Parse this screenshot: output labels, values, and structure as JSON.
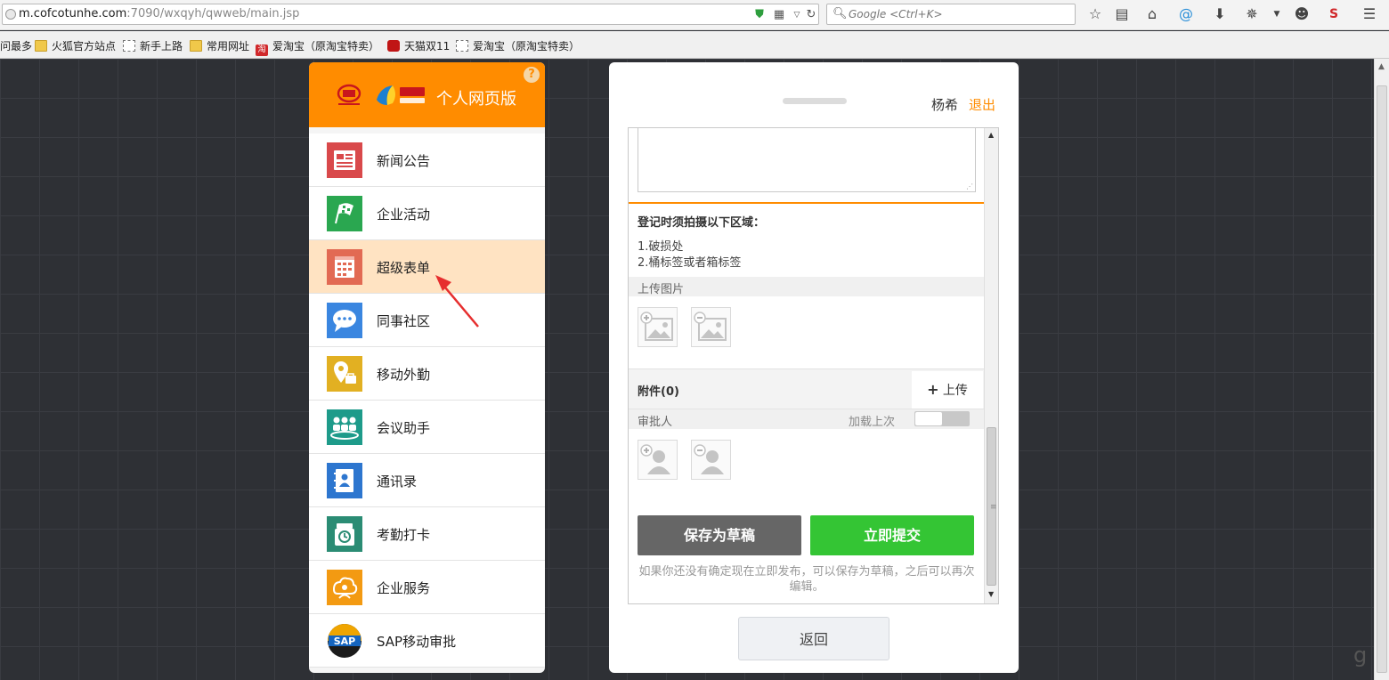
{
  "browser": {
    "url_host": "m.cofcotunhe.com",
    "url_path": ":7090/wxqyh/qwweb/main.jsp",
    "search_placeholder": "Google <Ctrl+K>",
    "bookmarks": [
      {
        "label": "问最多",
        "icon": "none"
      },
      {
        "label": "火狐官方站点",
        "icon": "folder-icon"
      },
      {
        "label": "新手上路",
        "icon": "page-icon"
      },
      {
        "label": "常用网址",
        "icon": "folder-icon"
      },
      {
        "label": "爱淘宝（原淘宝特卖）",
        "icon": "taobao-icon"
      },
      {
        "label": "天猫双11",
        "icon": "tmall-icon"
      },
      {
        "label": "爱淘宝（原淘宝特卖）",
        "icon": "page-icon"
      }
    ]
  },
  "left_panel": {
    "help": "?",
    "title": "个人网页版",
    "menu": [
      {
        "label": "新闻公告",
        "icon": "news-icon",
        "color": "#d9494b"
      },
      {
        "label": "企业活动",
        "icon": "flag-icon",
        "color": "#2aa750"
      },
      {
        "label": "超级表单",
        "icon": "form-icon",
        "color": "#e26a53",
        "active": true
      },
      {
        "label": "同事社区",
        "icon": "chat-icon",
        "color": "#3a86e0"
      },
      {
        "label": "移动外勤",
        "icon": "location-icon",
        "color": "#e2b022"
      },
      {
        "label": "会议助手",
        "icon": "meeting-icon",
        "color": "#1e9b8a"
      },
      {
        "label": "通讯录",
        "icon": "contacts-icon",
        "color": "#2d76cf"
      },
      {
        "label": "考勤打卡",
        "icon": "clock-icon",
        "color": "#2b8c74"
      },
      {
        "label": "企业服务",
        "icon": "service-icon",
        "color": "#f39a12"
      },
      {
        "label": "SAP移动审批",
        "icon": "sap-icon",
        "color": "#f0a500"
      }
    ]
  },
  "right_panel": {
    "user_name": "杨希",
    "logout": "退出",
    "photo_title": "登记时须拍摄以下区域：",
    "photo_line1": "1.破损处",
    "photo_line2": "2.桶标签或者箱标签",
    "upload_images_label": "上传图片",
    "attachments_label": "附件(0)",
    "upload_label": "上传",
    "approver_label": "审批人",
    "load_last_label": "加载上次",
    "save_draft": "保存为草稿",
    "submit_now": "立即提交",
    "hint": "如果你还没有确定现在立即发布，可以保存为草稿，之后可以再次编辑。",
    "back": "返回"
  },
  "watermark": "g"
}
